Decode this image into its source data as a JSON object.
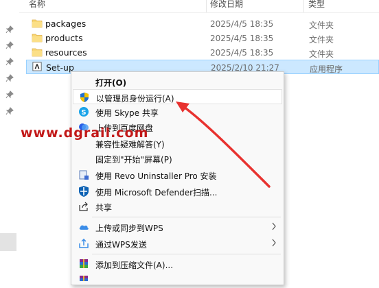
{
  "header": {
    "name_col": "名称",
    "date_col": "修改日期",
    "type_col": "类型"
  },
  "files": [
    {
      "name": "packages",
      "date": "2025/4/5 18:35",
      "type": "文件夹",
      "icon": "folder-icon"
    },
    {
      "name": "products",
      "date": "2025/4/5 18:35",
      "type": "文件夹",
      "icon": "folder-icon"
    },
    {
      "name": "resources",
      "date": "2025/4/5 18:35",
      "type": "文件夹",
      "icon": "folder-icon"
    },
    {
      "name": "Set-up",
      "date": "2025/2/10 21:27",
      "type": "应用程序",
      "icon": "installer-app-icon"
    }
  ],
  "context_menu": {
    "items": [
      {
        "label": "打开(O)",
        "icon": "",
        "bold": true
      },
      {
        "label": "以管理员身份运行(A)",
        "icon": "uac-shield-icon",
        "highlighted": true
      },
      {
        "label": "使用 Skype 共享",
        "icon": "skype-icon"
      },
      {
        "label": "上传到百度网盘",
        "icon": "baidu-netdisk-icon"
      },
      {
        "label": "兼容性疑难解答(Y)",
        "icon": ""
      },
      {
        "label": "固定到\"开始\"屏幕(P)",
        "icon": ""
      },
      {
        "label": "使用 Revo Uninstaller Pro 安装",
        "icon": "revo-uninstaller-icon"
      },
      {
        "label": "使用 Microsoft Defender扫描...",
        "icon": "defender-shield-icon"
      },
      {
        "label": "共享",
        "icon": "share-icon"
      },
      {
        "label": "上传或同步到WPS",
        "icon": "wps-cloud-icon",
        "submenu": true
      },
      {
        "label": "通过WPS发送",
        "icon": "wps-send-icon",
        "submenu": true
      },
      {
        "label": "添加到压缩文件(A)...",
        "icon": "winrar-icon"
      }
    ]
  },
  "watermark": {
    "text": "www.dgrail.com"
  },
  "colors": {
    "selection": "#cce8ff",
    "selection_border": "#99d1ff",
    "annotation_red": "#e8322f",
    "watermark_red": "#c21818",
    "folder_yellow": "#f8d775"
  }
}
